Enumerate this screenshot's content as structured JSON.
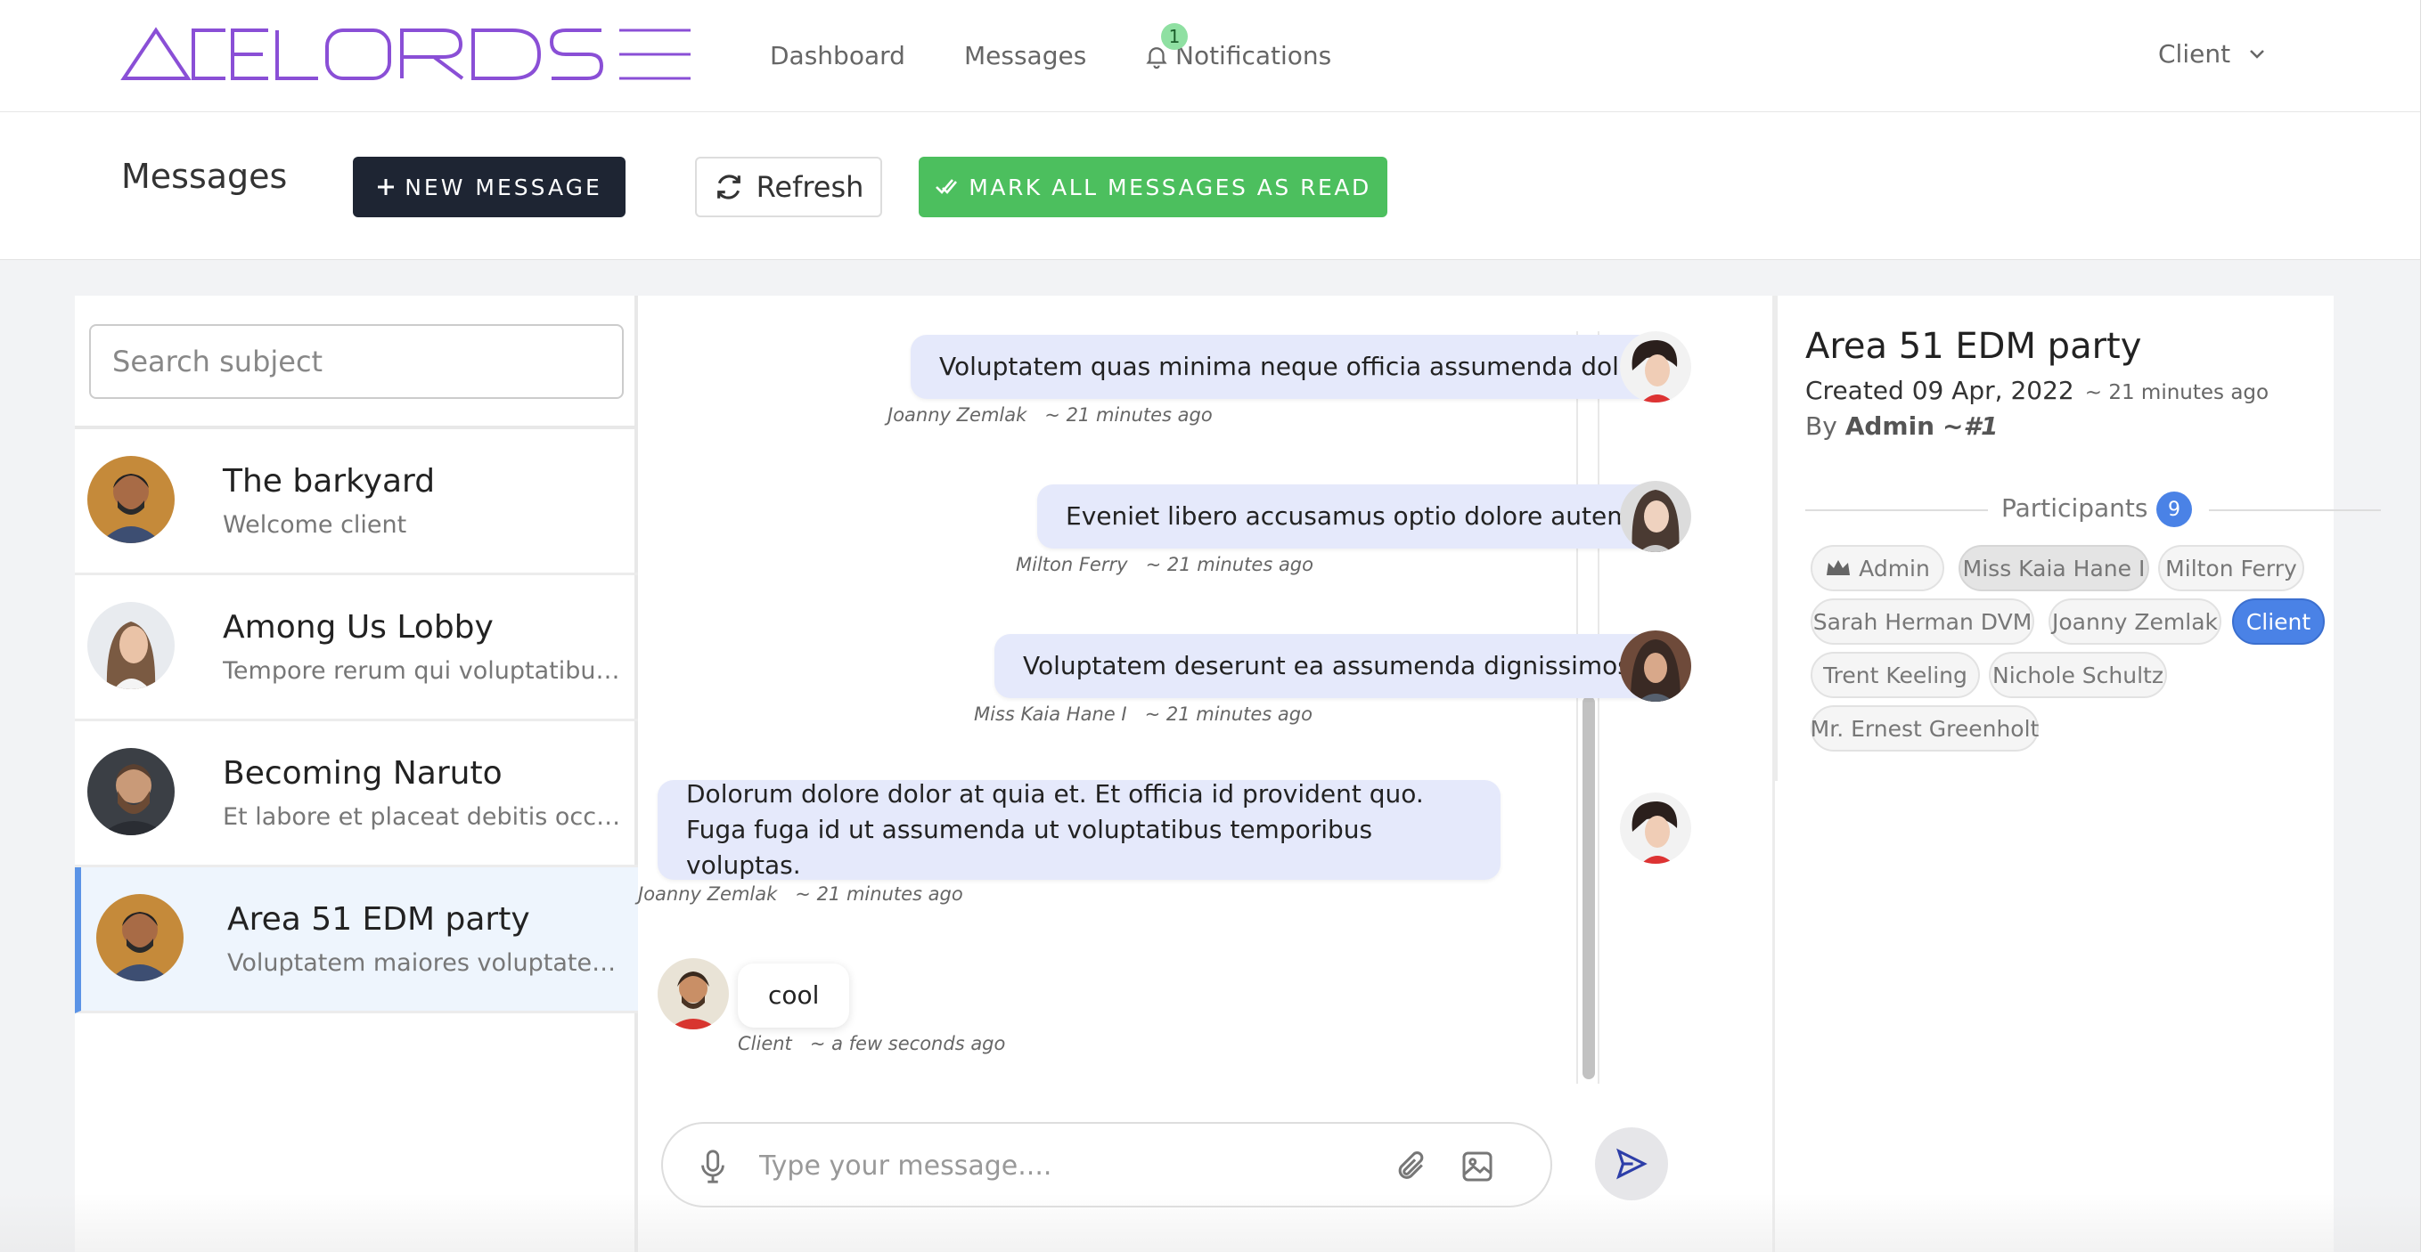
{
  "brand": {
    "name": "ACELORDS",
    "color": "#8a4fd6"
  },
  "nav": {
    "dashboard": "Dashboard",
    "messages": "Messages",
    "notifications": "Notifications",
    "notifications_count": "1",
    "user_menu": "Client"
  },
  "header": {
    "title": "Messages",
    "new_message": "NEW MESSAGE",
    "refresh": "Refresh",
    "mark_all_read": "MARK ALL MESSAGES AS READ"
  },
  "sidebar": {
    "search_placeholder": "Search subject",
    "conversations": [
      {
        "title": "The barkyard",
        "preview": "Welcome client",
        "active": false
      },
      {
        "title": "Among Us Lobby",
        "preview": "Tempore rerum qui voluptatibus odio",
        "active": false
      },
      {
        "title": "Becoming Naruto",
        "preview": "Et labore et placeat debitis occaecati",
        "active": false
      },
      {
        "title": "Area 51 EDM party",
        "preview": "Voluptatem maiores voluptatem quae",
        "active": true
      }
    ]
  },
  "chat": {
    "messages": [
      {
        "text": "Voluptatem quas minima neque officia assumenda dolor.",
        "author": "Joanny Zemlak",
        "time": "~ 21 minutes ago"
      },
      {
        "text": "Eveniet libero accusamus optio dolore autem.",
        "author": "Milton Ferry",
        "time": "~ 21 minutes ago"
      },
      {
        "text": "Voluptatem deserunt ea assumenda dignissimos.",
        "author": "Miss Kaia Hane I",
        "time": "~ 21 minutes ago"
      },
      {
        "text": "Dolorum dolore dolor at quia et. Et officia id provident quo. Fuga fuga id ut assumenda ut voluptatibus temporibus voluptas.",
        "author": "Joanny Zemlak",
        "time": "~ 21 minutes ago"
      },
      {
        "text": "cool",
        "author": "Client",
        "time": "~ a few seconds ago"
      }
    ],
    "composer_placeholder": "Type your message...."
  },
  "info": {
    "title": "Area 51 EDM party",
    "created": "Created 09 Apr, 2022",
    "created_ago": "~ 21 minutes ago",
    "by_label": "By",
    "by_name": "Admin",
    "by_id": "~#1",
    "participants_label": "Participants",
    "participants_count": "9",
    "participants": [
      "Admin",
      "Miss Kaia Hane I",
      "Milton Ferry",
      "Sarah Herman DVM",
      "Joanny Zemlak",
      "Client",
      "Trent Keeling",
      "Nichole Schultz",
      "Mr. Ernest Greenholt"
    ]
  },
  "colors": {
    "accent_blue": "#4a82e6",
    "success_green": "#4cbf5e",
    "dark_button": "#1e2533",
    "bubble_bg": "#e5e9fb"
  }
}
